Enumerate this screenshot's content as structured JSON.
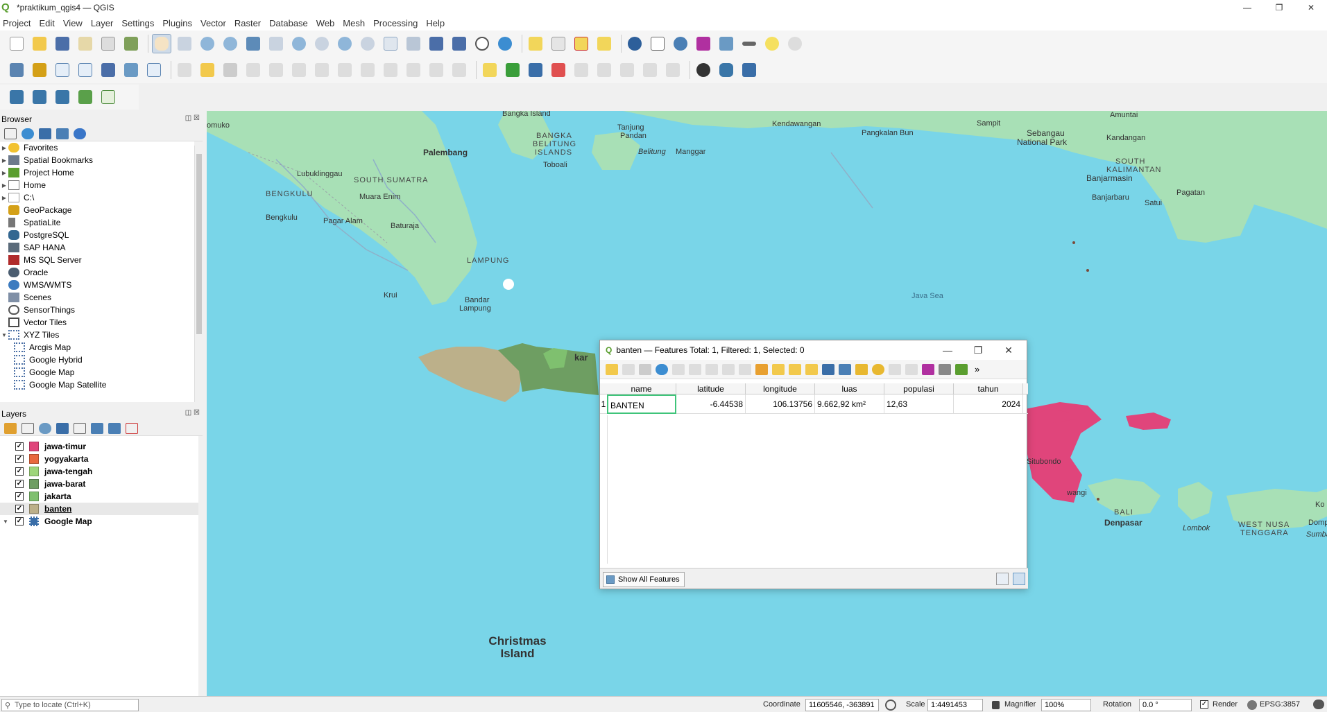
{
  "window": {
    "title": "*praktikum_qgis4 — QGIS",
    "logo_glyph": "Q",
    "minimize": "—",
    "maximize": "❐",
    "close": "✕"
  },
  "menu": [
    "Project",
    "Edit",
    "View",
    "Layer",
    "Settings",
    "Plugins",
    "Vector",
    "Raster",
    "Database",
    "Web",
    "Mesh",
    "Processing",
    "Help"
  ],
  "browser": {
    "title": "Browser",
    "items": [
      {
        "label": "Favorites",
        "icon": "star-icon",
        "color": "#f2c230"
      },
      {
        "label": "Spatial Bookmarks",
        "icon": "bookmark-icon",
        "color": "#6d7a8c"
      },
      {
        "label": "Project Home",
        "icon": "home-folder-icon",
        "color": "#5a9e2f"
      },
      {
        "label": "Home",
        "icon": "home-icon",
        "color": "#7a7a7a"
      },
      {
        "label": "C:\\",
        "icon": "folder-icon",
        "color": "#9a9a9a"
      },
      {
        "label": "GeoPackage",
        "icon": "geopackage-icon",
        "color": "#d4a017"
      },
      {
        "label": "SpatiaLite",
        "icon": "feather-icon",
        "color": "#555"
      },
      {
        "label": "PostgreSQL",
        "icon": "elephant-icon",
        "color": "#336791"
      },
      {
        "label": "SAP HANA",
        "icon": "database-icon",
        "color": "#5b6b7a"
      },
      {
        "label": "MS SQL Server",
        "icon": "mssql-icon",
        "color": "#b02b2b"
      },
      {
        "label": "Oracle",
        "icon": "oracle-icon",
        "color": "#4b5d70"
      },
      {
        "label": "WMS/WMTS",
        "icon": "globe-icon",
        "color": "#3c7bbf"
      },
      {
        "label": "Scenes",
        "icon": "cube-icon",
        "color": "#7f8fa6"
      },
      {
        "label": "SensorThings",
        "icon": "sensor-icon",
        "color": "#555"
      },
      {
        "label": "Vector Tiles",
        "icon": "grid-icon",
        "color": "#4a4a4a"
      },
      {
        "label": "XYZ Tiles",
        "icon": "tiles-icon",
        "color": "#4a6fa5"
      }
    ],
    "xyz_children": [
      "Arcgis Map",
      "Google Hybrid",
      "Google Map",
      "Google Map Satellite"
    ],
    "buttons": {
      "float": "◫",
      "close": "☒"
    }
  },
  "layers": {
    "title": "Layers",
    "items": [
      {
        "label": "jawa-timur",
        "color": "#e0457b",
        "checked": "✓"
      },
      {
        "label": "yogyakarta",
        "color": "#e8683e",
        "checked": "✓"
      },
      {
        "label": "jawa-tengah",
        "color": "#9ed67a",
        "checked": "✓"
      },
      {
        "label": "jawa-barat",
        "color": "#6e9e62",
        "checked": "✓"
      },
      {
        "label": "jakarta",
        "color": "#7fc06f",
        "checked": "✓"
      },
      {
        "label": "banten",
        "color": "#bcb08a",
        "checked": "✓"
      },
      {
        "label": "Google Map",
        "color": "#3a6ea8",
        "checked": "✓"
      }
    ]
  },
  "map": {
    "labels": {
      "bangka": "Bangka Island",
      "omuko": "omuko",
      "palembang": "Palembang",
      "bangka_belitung_1": "BANGKA",
      "bangka_belitung_2": "BELITUNG",
      "bangka_belitung_3": "ISLANDS",
      "toboali": "Toboali",
      "tanjung_pandan_1": "Tanjung",
      "tanjung_pandan_2": "Pandan",
      "belitung": "Belitung",
      "manggar": "Manggar",
      "kendawangan": "Kendawangan",
      "pangkalan_bun": "Pangkalan Bun",
      "sampit": "Sampit",
      "sebangau_1": "Sebangau",
      "sebangau_2": "National Park",
      "amuntai": "Amuntai",
      "kandangan": "Kandangan",
      "kalsel_1": "SOUTH",
      "kalsel_2": "KALIMANTAN",
      "banjarmasin": "Banjarmasin",
      "banjarbaru": "Banjarbaru",
      "satui": "Satui",
      "pagatan": "Pagatan",
      "lubuklinggau": "Lubuklinggau",
      "sumsel": "SOUTH SUMATRA",
      "bengkulu_prov": "BENGKULU",
      "muara_enim": "Muara Enim",
      "bengkulu_city": "Bengkulu",
      "pagar_alam": "Pagar Alam",
      "baturaja": "Baturaja",
      "lampung": "LAMPUNG",
      "java_sea": "Java Sea",
      "krui": "Krui",
      "bandar_lampung_1": "Bandar",
      "bandar_lampung_2": "Lampung",
      "jakarta_partial": "kar",
      "situbondo": "Situbondo",
      "wangi": "wangi",
      "bali_1": "BALI",
      "denpasar": "Denpasar",
      "lombok": "Lombok",
      "ntb_1": "WEST NUSA",
      "ntb_2": "TENGGARA",
      "sumbawa": "Sumbawa",
      "ko": "Ko",
      "domp": "Domp",
      "christmas_1": "Christmas",
      "christmas_2": "Island"
    }
  },
  "attribute_table": {
    "title": "banten — Features Total: 1, Filtered: 1, Selected: 0",
    "columns": [
      "name",
      "latitude",
      "longitude",
      "luas",
      "populasi",
      "tahun"
    ],
    "rows": [
      {
        "row_num": "1",
        "name": "BANTEN",
        "latitude": "-6.44538",
        "longitude": "106.13756",
        "luas": "9.662,92 km²",
        "populasi": "12,63",
        "tahun": "2024"
      }
    ],
    "show_all_button": "Show All Features",
    "more": "»"
  },
  "statusbar": {
    "locator_placeholder": "Type to locate (Ctrl+K)",
    "coordinate_label": "Coordinate",
    "coordinate_value": "11605546, -363891",
    "scale_label": "Scale",
    "scale_value": "1:4491453",
    "magnifier_label": "Magnifier",
    "magnifier_value": "100%",
    "rotation_label": "Rotation",
    "rotation_value": "0.0 °",
    "render_label": "Render",
    "crs": "EPSG:3857"
  }
}
